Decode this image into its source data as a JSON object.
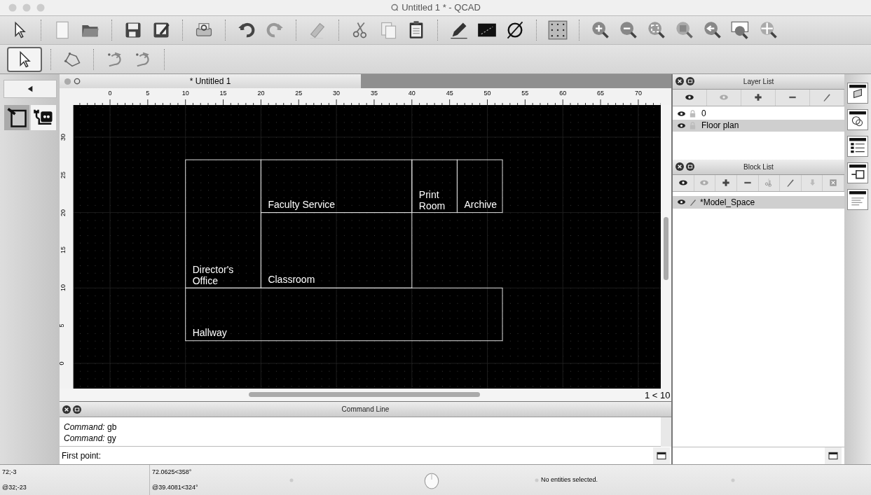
{
  "window": {
    "title": "Untitled 1 * - QCAD"
  },
  "document": {
    "title": "* Untitled 1",
    "ruler_h": [
      "0",
      "5",
      "10",
      "15",
      "20",
      "25",
      "30",
      "35",
      "40",
      "45",
      "50",
      "55",
      "60",
      "65",
      "70"
    ],
    "ruler_v": [
      "0",
      "5",
      "10",
      "15",
      "20",
      "25",
      "30"
    ],
    "scale": "1 < 10",
    "rooms": [
      {
        "label": "Faculty Service"
      },
      {
        "label": "Print Room"
      },
      {
        "label": "Archive"
      },
      {
        "label": "Director's Office"
      },
      {
        "label": "Classroom"
      },
      {
        "label": "Hallway"
      }
    ]
  },
  "layer_list": {
    "title": "Layer List",
    "layers": [
      {
        "name": "0",
        "selected": false
      },
      {
        "name": "Floor plan",
        "selected": true
      }
    ]
  },
  "block_list": {
    "title": "Block List",
    "blocks": [
      {
        "name": "*Model_Space",
        "selected": true
      }
    ]
  },
  "command_line": {
    "title": "Command Line",
    "history": [
      {
        "label": "Command:",
        "value": "gb"
      },
      {
        "label": "Command:",
        "value": "gy"
      }
    ],
    "prompt": "First point:"
  },
  "status_bar": {
    "abs": "72;-3",
    "rel": "@32;-23",
    "polar_abs": "72.0625<358°",
    "polar_rel": "@39.4081<324°",
    "selection": "No entities selected."
  }
}
